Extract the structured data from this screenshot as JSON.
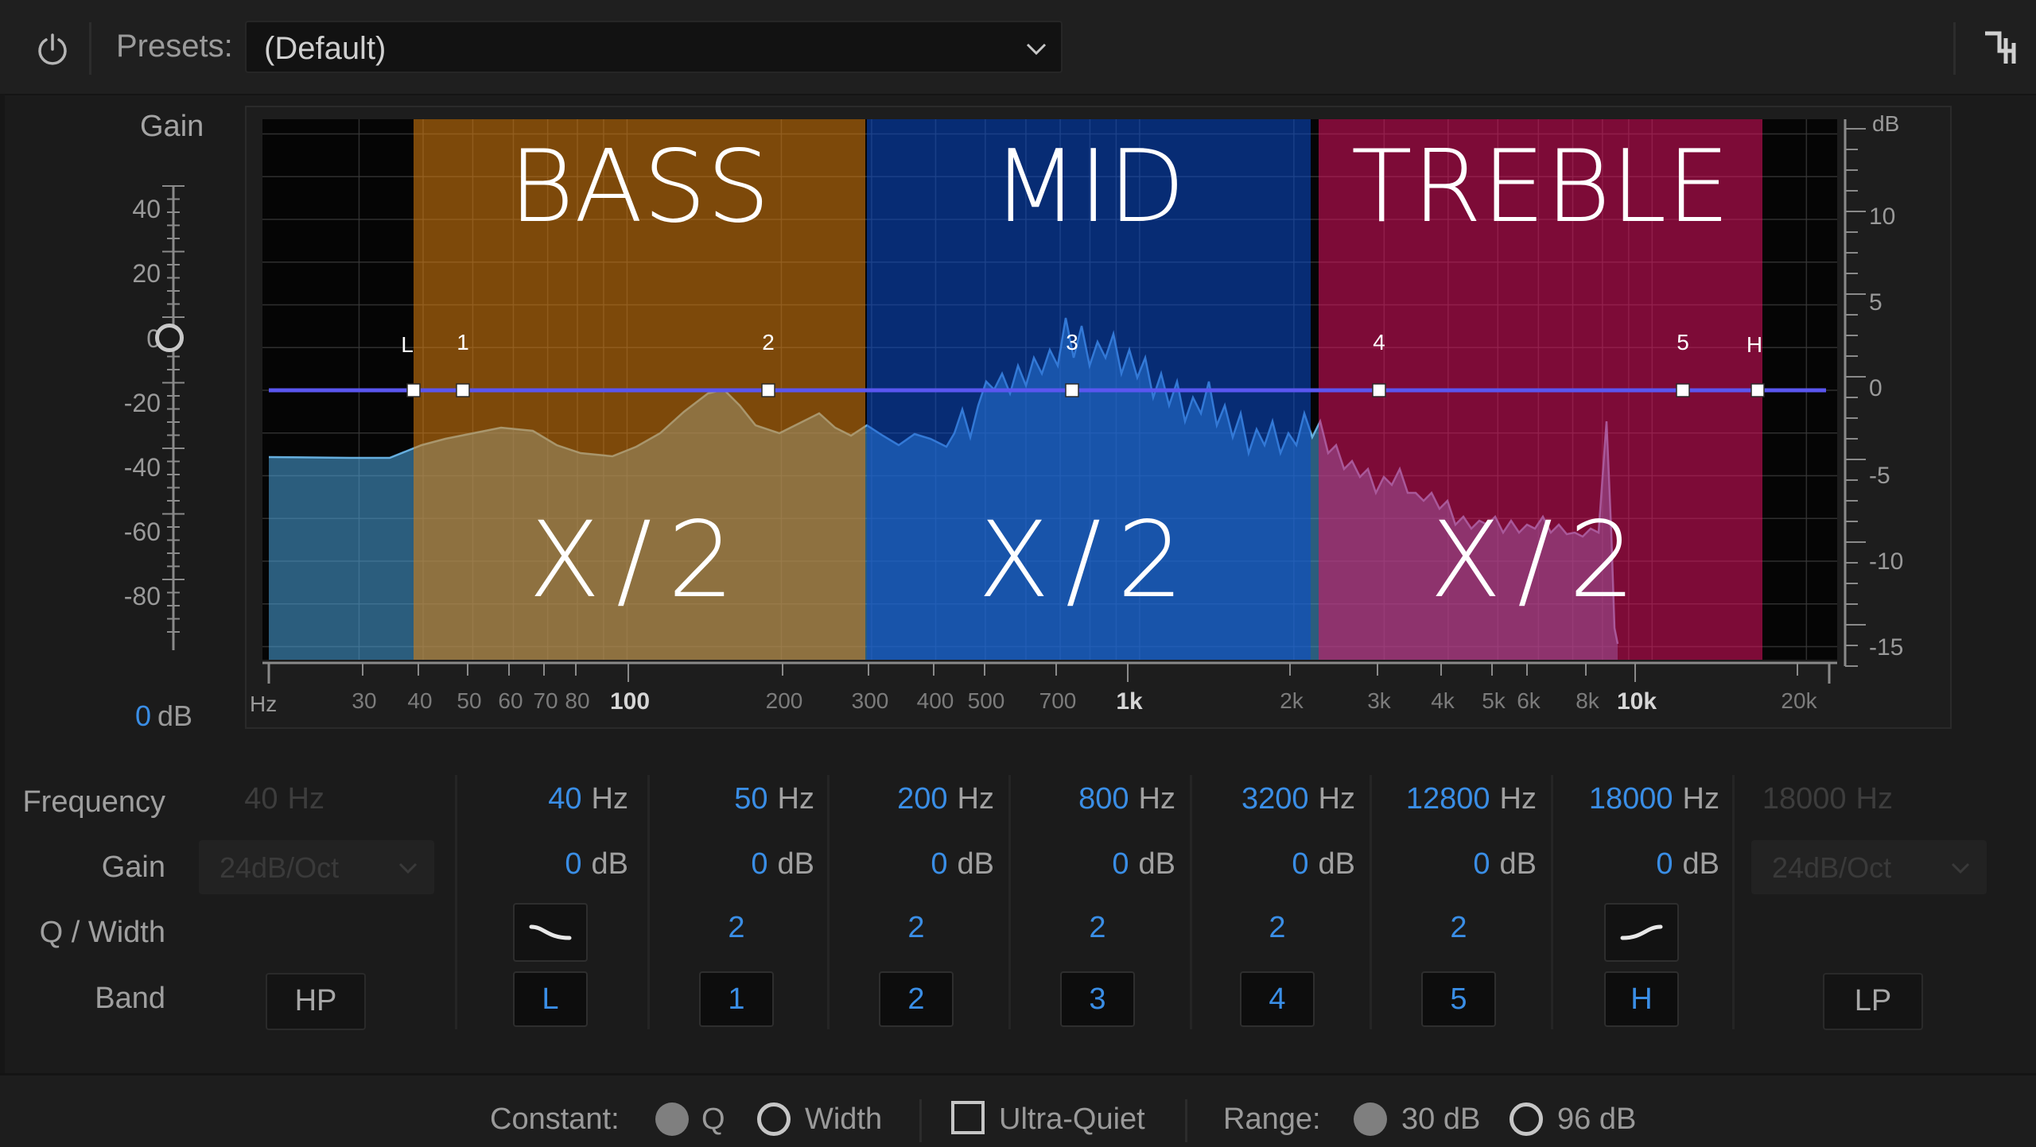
{
  "toolbar": {
    "presets_label": "Presets:",
    "preset_value": "(Default)"
  },
  "gain": {
    "title": "Gain",
    "ticks": [
      "40",
      "20",
      "0",
      "-20",
      "-40",
      "-60",
      "-80"
    ],
    "value": "0",
    "unit": "dB"
  },
  "graph": {
    "db_axis_title": "dB",
    "db_ticks": [
      "10",
      "5",
      "0",
      "-5",
      "-10",
      "-15"
    ],
    "hz_axis_title": "Hz",
    "hz_ticks": [
      "30",
      "40",
      "50",
      "60",
      "70",
      "80",
      "100",
      "200",
      "300",
      "400",
      "500",
      "700",
      "1k",
      "2k",
      "3k",
      "4k",
      "5k",
      "6k",
      "8k",
      "10k",
      "20k"
    ],
    "overlays": [
      {
        "title": "BASS",
        "subtitle": "X/2",
        "color": "#e0810f"
      },
      {
        "title": "MID",
        "subtitle": "X/2",
        "color": "#0a4dcf"
      },
      {
        "title": "TREBLE",
        "subtitle": "X/2",
        "color": "#e01060"
      }
    ],
    "nodes": [
      {
        "label": "L",
        "freq": 40
      },
      {
        "label": "1",
        "freq": 50
      },
      {
        "label": "2",
        "freq": 200
      },
      {
        "label": "3",
        "freq": 800
      },
      {
        "label": "4",
        "freq": 3200
      },
      {
        "label": "5",
        "freq": 12800
      },
      {
        "label": "H",
        "freq": 18000
      }
    ],
    "eq_curve_color": "#5a56f0",
    "spectrum_color": "#4aa6e0"
  },
  "params": {
    "row_labels": {
      "frequency": "Frequency",
      "gain": "Gain",
      "q": "Q / Width",
      "band": "Band"
    },
    "hp": {
      "freq": "40",
      "freq_unit": "Hz",
      "slope": "24dB/Oct",
      "band": "HP"
    },
    "bands": [
      {
        "freq": "40",
        "freq_unit": "Hz",
        "gain": "0",
        "gain_unit": "dB",
        "q": "",
        "band": "L",
        "shape": "low-shelf-icon"
      },
      {
        "freq": "50",
        "freq_unit": "Hz",
        "gain": "0",
        "gain_unit": "dB",
        "q": "2",
        "band": "1"
      },
      {
        "freq": "200",
        "freq_unit": "Hz",
        "gain": "0",
        "gain_unit": "dB",
        "q": "2",
        "band": "2"
      },
      {
        "freq": "800",
        "freq_unit": "Hz",
        "gain": "0",
        "gain_unit": "dB",
        "q": "2",
        "band": "3"
      },
      {
        "freq": "3200",
        "freq_unit": "Hz",
        "gain": "0",
        "gain_unit": "dB",
        "q": "2",
        "band": "4"
      },
      {
        "freq": "12800",
        "freq_unit": "Hz",
        "gain": "0",
        "gain_unit": "dB",
        "q": "2",
        "band": "5"
      },
      {
        "freq": "18000",
        "freq_unit": "Hz",
        "gain": "0",
        "gain_unit": "dB",
        "q": "",
        "band": "H",
        "shape": "high-shelf-icon"
      }
    ],
    "lp": {
      "freq": "18000",
      "freq_unit": "Hz",
      "slope": "24dB/Oct",
      "band": "LP"
    }
  },
  "footer": {
    "constant_label": "Constant:",
    "constant_q": "Q",
    "constant_width": "Width",
    "ultra_quiet": "Ultra-Quiet",
    "range_label": "Range:",
    "range_30": "30 dB",
    "range_96": "96 dB"
  }
}
